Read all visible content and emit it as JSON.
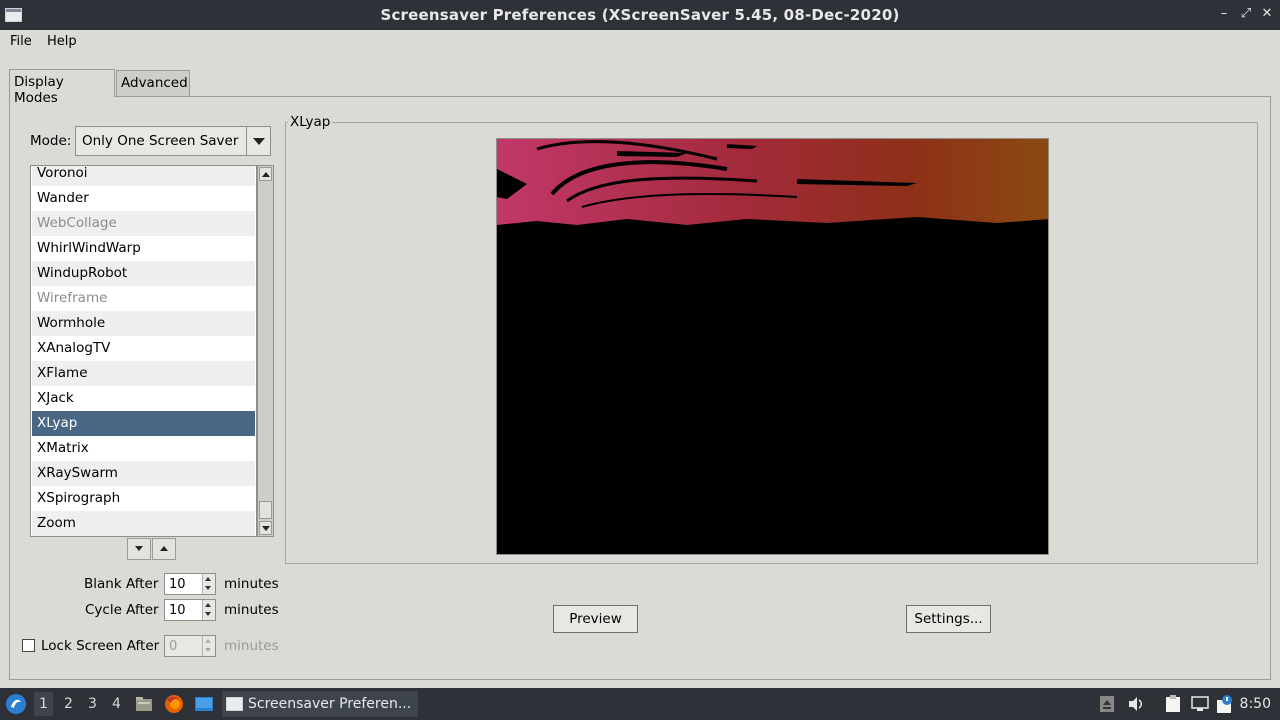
{
  "window": {
    "title": "Screensaver Preferences  (XScreenSaver 5.45, 08-Dec-2020)",
    "minimize_glyph": "–",
    "maximize_glyph": "⤢",
    "close_glyph": "✕"
  },
  "menu": {
    "file": "File",
    "help": "Help"
  },
  "tabs": {
    "display_modes": "Display Modes",
    "advanced": "Advanced"
  },
  "mode": {
    "label": "Mode:",
    "value": "Only One Screen Saver"
  },
  "screensavers": [
    {
      "name": "Voronoi",
      "disabled": false
    },
    {
      "name": "Wander",
      "disabled": false
    },
    {
      "name": "WebCollage",
      "disabled": true
    },
    {
      "name": "WhirlWindWarp",
      "disabled": false
    },
    {
      "name": "WindupRobot",
      "disabled": false
    },
    {
      "name": "Wireframe",
      "disabled": true
    },
    {
      "name": "Wormhole",
      "disabled": false
    },
    {
      "name": "XAnalogTV",
      "disabled": false
    },
    {
      "name": "XFlame",
      "disabled": false
    },
    {
      "name": "XJack",
      "disabled": false
    },
    {
      "name": "XLyap",
      "disabled": false,
      "selected": true
    },
    {
      "name": "XMatrix",
      "disabled": false
    },
    {
      "name": "XRaySwarm",
      "disabled": false
    },
    {
      "name": "XSpirograph",
      "disabled": false
    },
    {
      "name": "Zoom",
      "disabled": false
    }
  ],
  "timing": {
    "blank_label": "Blank After",
    "blank_value": "10",
    "cycle_label": "Cycle After",
    "cycle_value": "10",
    "lock_label": "Lock Screen After",
    "lock_value": "0",
    "lock_checked": false,
    "units": "minutes"
  },
  "preview": {
    "group_title": "XLyap",
    "preview_button": "Preview",
    "settings_button": "Settings..."
  },
  "taskbar": {
    "workspaces": [
      "1",
      "2",
      "3",
      "4"
    ],
    "active_workspace": "1",
    "task_label": "Screensaver Preferen...",
    "clock": "8:50"
  },
  "colors": {
    "selection": "#4a6685",
    "titlebar": "#2e3238",
    "background": "#dcdad5"
  }
}
